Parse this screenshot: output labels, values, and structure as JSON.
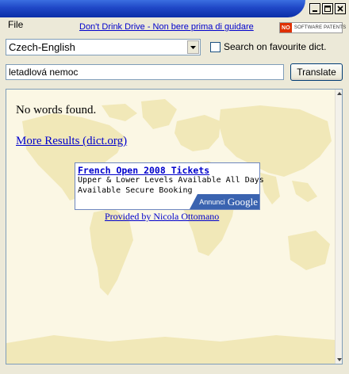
{
  "menu": {
    "file_label": "File"
  },
  "header": {
    "ad_link": "Don't Drink  Drive - Non bere prima di guidare",
    "badge_no": "NO",
    "badge_text": "SOFTWARE PATENTS"
  },
  "dictionary": {
    "selected": "Czech-English"
  },
  "favourite": {
    "label": "Search on favourite dict.",
    "checked": false
  },
  "search": {
    "value": "letadlová nemoc"
  },
  "translate": {
    "label": "Translate"
  },
  "results": {
    "message": "No words found.",
    "more_results": "More Results (dict.org)",
    "provided_by": "Provided by Nicola Ottomano"
  },
  "ad": {
    "title": "French Open 2008 Tickets",
    "line1": "Upper & Lower Levels Available All Days",
    "line2": "Available Secure Booking",
    "annunci": "Annunci",
    "google": "Google"
  },
  "colors": {
    "titlebar": "#1f47c6",
    "link": "#0000cc",
    "content_bg": "#fbf7e4",
    "map": "#f1e8b8"
  }
}
